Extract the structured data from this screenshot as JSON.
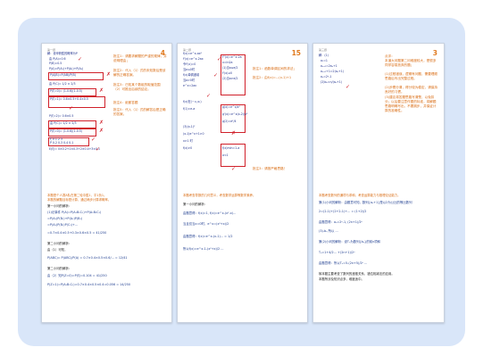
{
  "pages": [
    {
      "number": "4",
      "header": "第一题",
      "comments": [
        "批注1：请要求解题的严谨的规律，并说明理由；",
        "批注2：代入（1）式的未知数后是该解的正确答案。",
        "批注3：已知某个数组的取值范围（2）可推出后续的结论。",
        "批注4：纸都答题",
        "批注5：代入（1）式的解答后是正确的答案。"
      ],
      "hand_lines": [
        "解：设甲获胜的概率为P",
        "由 P(A)=0.6",
        "P(B)=0.5",
        "P(A)=P(A₁)+P(A₂)+P(A₃)",
        "P(A|B)=P(AB)/P(B)",
        "由 P(C)= 1/2 × 2/3",
        "P(ξ=0)= (1-0.6)(1-0.5)",
        "P(ξ=1)= 0.6×0.5+0.4×0.5",
        "P(ξ=2)= 0.6×0.5",
        "ξ  0   1   2   3",
        "P  0.2 0.3 0.4 0.1",
        "E(ξ)= 0×0.2+1×0.3+2×0.4+3×0.1"
      ],
      "printed": [
        "本题是个人赛A队在第二轮中胜1，平1负1。",
        "本题的解题目标是计算，通过两步计算求概率。",
        "第一小问的解析：",
        "(1)记事件 P(A)=P(A₁B₁C₁)+P(A₁B₂C₁)",
        "=P(A₁)P(B₁)+P(A₂)P(B₁)",
        "=P(A₁)P(B₁)P(C₁)+...",
        "=0.7×0.4×0.5+0.3×0.6×0.5 = 41/250",
        "第二小问的解析：",
        "由（1）可知，",
        "P(ABC)= P(ABC)/P(A) = 0.7×0.4×0.5×0.6/... = 12/41",
        "第二小问的解析：",
        "由（2）知P(Z=0)=P(ξ)=0.104 = 41/250",
        "P(Z=1)=P(A₁B₁C₁)=0.7×0.4×0.5×0.4=0.056 = 14/250"
      ]
    },
    {
      "number": "15",
      "header": "第二题",
      "comments": [
        "批注1：函数单调区间的求法；",
        "批注2：由f(x)=...(x-1)+1"
      ],
      "comment_bottom": "批注3：请按严格思路！",
      "hand_lines": [
        "f(x)=e^x-ax²",
        "f'(x)=e^x-2ax",
        "令f'(x)=0",
        "当a≤0时",
        "f(x)单调递增",
        "当a>0时",
        "e^x=2ax",
        "f''(x)=e^x-2a",
        "x=ln2a",
        "(1)当a≤e/2",
        "f'(x)≥0",
        "(2)当a>e/2",
        "f(x)在(−∞,x₁)",
        "f(1)=e-a",
        "g(x)=e^x/x²",
        "g'(x)=e^x(x-2)/x³",
        "g(2)=e²/4",
        "(3)(x-1)²",
        "(x-1)e^x+1>0",
        "x>1 时",
        "f(x)>0",
        "f(x)min=1-a",
        "a<1"
      ],
      "printed": [
        "本题考查导数的几何意义，考查数学运算等数学素养。",
        "第一小问的解析：",
        "由题意得：f(x)=1, f(x)=e^x-(x²-x)...",
        "当且仅当x=0时，e^x=(x²+x)/2",
        "由题意得：f(x)=e^x-(x-1)... = 1/2",
        "所以f(x)=e^x-1-(x²+x)/2 ..."
      ]
    },
    {
      "number": "3",
      "header": "第三题",
      "comments_orange": [
        "点评：",
        "本道大问题第二问难度较大，是很多同学容易放弃的题；",
        "(1)过程错误，逻辑有问题，需要理顺思路后写出完整过程。",
        "(2)步骤分清，得分较为稳定，请保持良好的习惯。",
        "(3)建议将答题思路写清楚，以免扣分；以后要注意作图的标准，将解题思路明确写出，不要跳步，并保证计算的准确性。"
      ],
      "hand_lines": [
        "解：(1)",
        "a₁=1",
        "aₙ₊₁=2aₙ+1",
        "aₙ₊₁+1=2(aₙ+1)",
        "aₙ=2ⁿ-1",
        "(2)bₙ=n/(aₙ+1)",
        "Sₙ=1/2+2/4+...",
        "Sₙ=2-(n+2)/2ⁿ"
      ],
      "printed": [
        "本题考查数列的通项与求和，考查运算能力与推理论证能力。",
        "第(1)小问的解析：由题意可知，数列{aₙ+1}是以2为公比的等比数列",
        "2=(2-1)+(2+2-1)+... = (1+2)/2",
        "由题意得：aₙ=2ⁿ-1,  (2n+1)/2ⁿ",
        "(3)-bₙ 所以 ...",
        "第(2)小问的解析：设Tₙ为数列{bₙ}的前n项和",
        "Tₙ=1+4/2... +(2n+1)/2ⁿ",
        "由题意得：所以Tₙ=5-(2n+5)/2ⁿ ...",
        "故本题主要考查了数列的递推关系，错位相减法的应用。",
        "本题所涉及知识点多，难度适中。"
      ]
    }
  ]
}
